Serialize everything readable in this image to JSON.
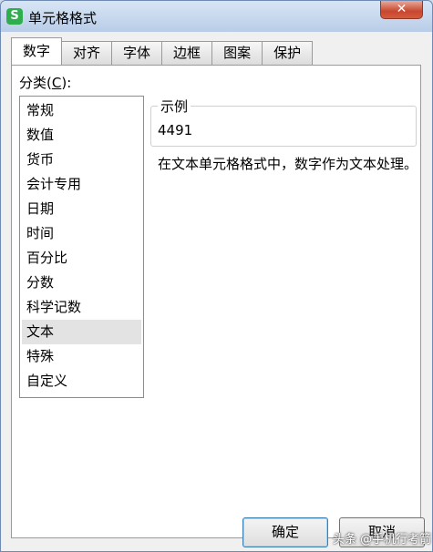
{
  "window": {
    "title": "单元格格式",
    "app_icon": "S",
    "close_glyph": "✕"
  },
  "tabs": [
    {
      "label": "数字",
      "active": true
    },
    {
      "label": "对齐"
    },
    {
      "label": "字体"
    },
    {
      "label": "边框"
    },
    {
      "label": "图案"
    },
    {
      "label": "保护"
    }
  ],
  "category": {
    "label_prefix": "分类(",
    "label_hotkey": "C",
    "label_suffix": "):",
    "items": [
      "常规",
      "数值",
      "货币",
      "会计专用",
      "日期",
      "时间",
      "百分比",
      "分数",
      "科学记数",
      "文本",
      "特殊",
      "自定义"
    ],
    "selected": "文本"
  },
  "sample": {
    "legend": "示例",
    "value": "4491"
  },
  "description": "在文本单元格格式中，数字作为文本处理。",
  "buttons": {
    "ok": "确定",
    "cancel": "取消"
  },
  "watermark": "头条 @手机行考箭"
}
